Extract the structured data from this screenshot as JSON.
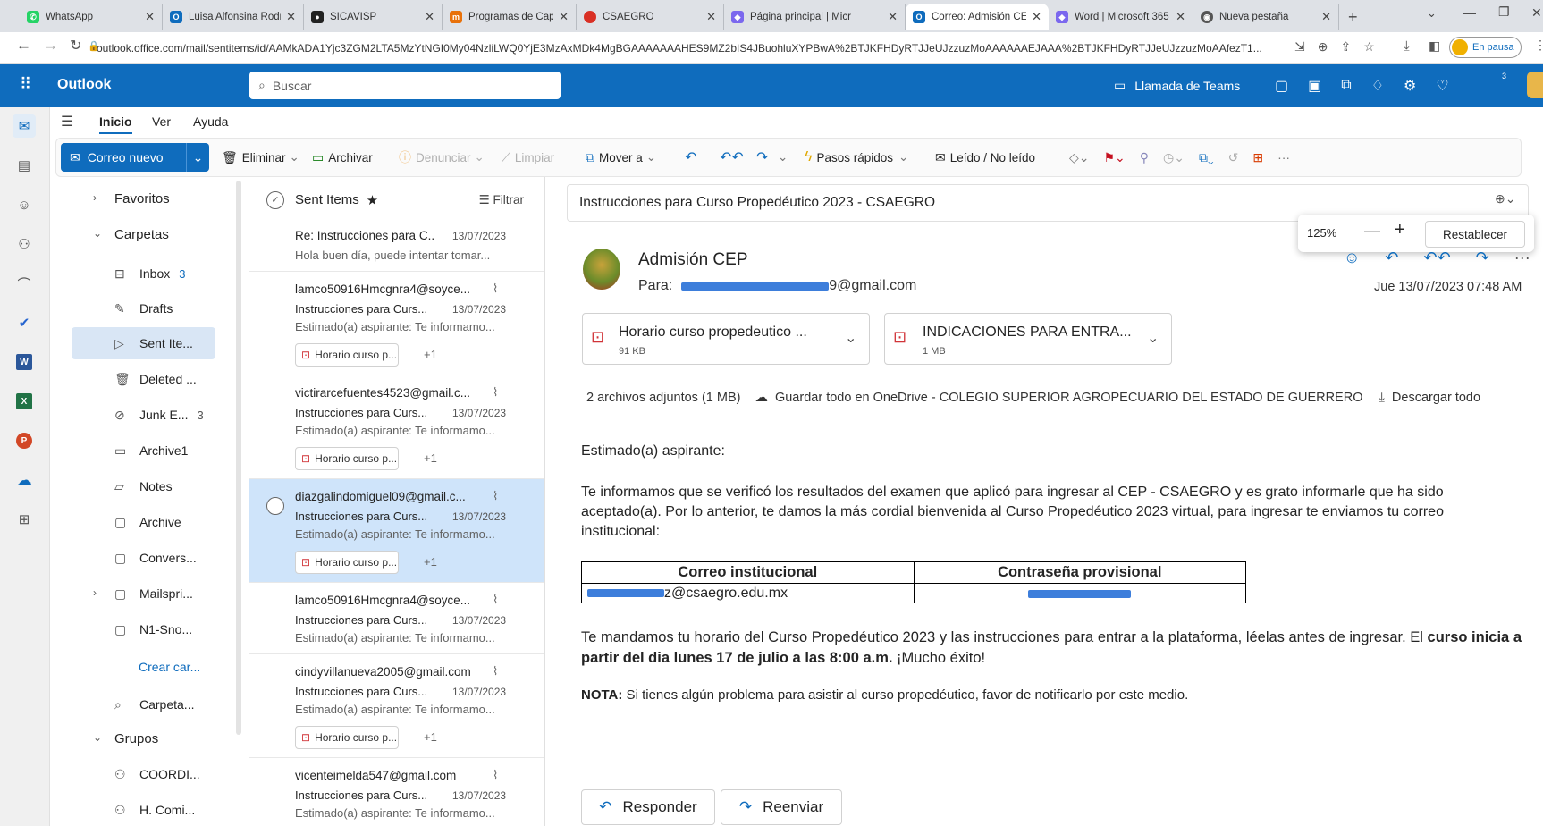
{
  "browser": {
    "tabs": [
      {
        "label": "WhatsApp",
        "color": "#25d366",
        "glyph": "✆"
      },
      {
        "label": "Luisa Alfonsina Rodrig",
        "color": "#0f6cbd",
        "glyph": "O"
      },
      {
        "label": "SICAVISP",
        "color": "#222222",
        "glyph": "●"
      },
      {
        "label": "Programas de Capacit",
        "color": "#e8710a",
        "glyph": "m"
      },
      {
        "label": "CSAEGRO",
        "color": "#d93025",
        "glyph": "●"
      },
      {
        "label": "Página principal | Micr",
        "color": "#7b68ee",
        "glyph": "◆"
      },
      {
        "label": "Correo: Admisión CEP",
        "color": "#0f6cbd",
        "glyph": "O"
      },
      {
        "label": "Word | Microsoft 365",
        "color": "#7b68ee",
        "glyph": "◆"
      },
      {
        "label": "Nueva pestaña",
        "color": "#555555",
        "glyph": "◉"
      }
    ],
    "url": "outlook.office.com/mail/sentitems/id/AAMkADA1Yjc3ZGM2LTA5MzYtNGI0My04NzliLWQ0YjE3MzAxMDk4MgBGAAAAAAAHES9MZ2bIS4JBuohluXYPBwA%2BTJKFHDyRTJJeUJzzuzMoAAAAAAEJAAA%2BTJKFHDyRTJJeUJzzuzMoAAfezT1...",
    "profile_label": "En pausa"
  },
  "app": {
    "name": "Outlook",
    "search_placeholder": "Buscar",
    "teams_call": "Llamada de Teams",
    "notif_count": "3"
  },
  "menu": {
    "items": [
      "Inicio",
      "Ver",
      "Ayuda"
    ]
  },
  "ribbon": {
    "new_mail": "Correo nuevo",
    "delete": "Eliminar",
    "archive": "Archivar",
    "report": "Denunciar",
    "sweep": "Limpiar",
    "move": "Mover a",
    "quick_steps": "Pasos rápidos",
    "read_unread": "Leído / No leído",
    "more": "···"
  },
  "folders": {
    "favorites": "Favoritos",
    "folders_header": "Carpetas",
    "items": [
      {
        "label": "Inbox",
        "count": "3",
        "icon": "inbox-icon"
      },
      {
        "label": "Drafts",
        "count": "",
        "icon": "drafts-icon"
      },
      {
        "label": "Sent Ite...",
        "count": "",
        "icon": "sent-icon"
      },
      {
        "label": "Deleted ...",
        "count": "",
        "icon": "trash-icon"
      },
      {
        "label": "Junk E...",
        "count": "3",
        "icon": "junk-icon"
      },
      {
        "label": "Archive1",
        "count": "",
        "icon": "archive-icon"
      },
      {
        "label": "Notes",
        "count": "",
        "icon": "notes-icon"
      },
      {
        "label": "Archive",
        "count": "",
        "icon": "folder-icon"
      },
      {
        "label": "Convers...",
        "count": "",
        "icon": "folder-icon"
      },
      {
        "label": "Mailspri...",
        "count": "",
        "icon": "folder-icon"
      },
      {
        "label": "N1-Sno...",
        "count": "",
        "icon": "folder-icon"
      }
    ],
    "create": "Crear car...",
    "search_folders": "Carpeta...",
    "groups_header": "Grupos",
    "groups": [
      "COORDI...",
      "H. Comi..."
    ]
  },
  "list": {
    "title": "Sent Items",
    "filter": "Filtrar",
    "messages": [
      {
        "from": "",
        "subject": "Re: Instrucciones para C...",
        "date": "13/07/2023",
        "preview": "Hola buen día, puede intentar tomar...",
        "attachment": "",
        "more": ""
      },
      {
        "from": "lamco50916Hmcgnra4@soyce...",
        "subject": "Instrucciones para Curs...",
        "date": "13/07/2023",
        "preview": "Estimado(a) aspirante: Te informamo...",
        "attachment": "Horario curso p...",
        "more": "+1"
      },
      {
        "from": "victirarcefuentes4523@gmail.c...",
        "subject": "Instrucciones para Curs...",
        "date": "13/07/2023",
        "preview": "Estimado(a) aspirante: Te informamo...",
        "attachment": "Horario curso p...",
        "more": "+1"
      },
      {
        "from": "diazgalindomiguel09@gmail.c...",
        "subject": "Instrucciones para Curs...",
        "date": "13/07/2023",
        "preview": "Estimado(a) aspirante: Te informamo...",
        "attachment": "Horario curso p...",
        "more": "+1"
      },
      {
        "from": "lamco50916Hmcgnra4@soyce...",
        "subject": "Instrucciones para Curs...",
        "date": "13/07/2023",
        "preview": "Estimado(a) aspirante: Te informamo...",
        "attachment": "",
        "more": ""
      },
      {
        "from": "cindyvillanueva2005@gmail.com",
        "subject": "Instrucciones para Curs...",
        "date": "13/07/2023",
        "preview": "Estimado(a) aspirante: Te informamo...",
        "attachment": "Horario curso p...",
        "more": "+1"
      },
      {
        "from": "vicenteimelda547@gmail.com",
        "subject": "Instrucciones para Curs...",
        "date": "13/07/2023",
        "preview": "Estimado(a) aspirante: Te informamo...",
        "attachment": "",
        "more": ""
      }
    ]
  },
  "reading": {
    "subject": "Instrucciones para Curso Propedéutico 2023 - CSAEGRO",
    "zoom": "125%",
    "zoom_reset": "Restablecer",
    "sender": "Admisión CEP",
    "to_label": "Para:",
    "to_visible": "9@gmail.com",
    "date": "Jue 13/07/2023 07:48 AM",
    "attachments": [
      {
        "name": "Horario curso propedeutico ...",
        "size": "91 KB"
      },
      {
        "name": "INDICACIONES PARA ENTRA...",
        "size": "1 MB"
      }
    ],
    "attach_summary": "2 archivos adjuntos (1 MB)",
    "save_onedrive": "Guardar todo en OneDrive - COLEGIO SUPERIOR AGROPECUARIO DEL ESTADO DE GUERRERO",
    "download_all": "Descargar todo",
    "greeting": "Estimado(a) aspirante:",
    "para1": "Te informamos que se verificó los resultados del examen que aplicó para ingresar al CEP - CSAEGRO y es grato informarle que ha sido aceptado(a). Por lo anterior, te damos la más cordial bienvenida al Curso Propedéutico 2023 virtual, para ingresar te enviamos tu correo institucional:",
    "table_headers": [
      "Correo institucional",
      "Contraseña provisional"
    ],
    "table_email": "z@csaegro.edu.mx",
    "para2_normal": "Te mandamos tu horario del Curso Propedéutico 2023 y las instrucciones para entrar a la plataforma, léelas antes de ingresar. El ",
    "para2_bold": "curso inicia a partir del dia lunes 17 de julio a las 8:00 a.m.",
    "para2_end": " ¡Mucho éxito!",
    "note_label": "NOTA:",
    "note_text": " Si tienes algún problema para asistir al curso propedéutico, favor de notificarlo por este medio.",
    "reply": "Responder",
    "forward": "Reenviar"
  }
}
